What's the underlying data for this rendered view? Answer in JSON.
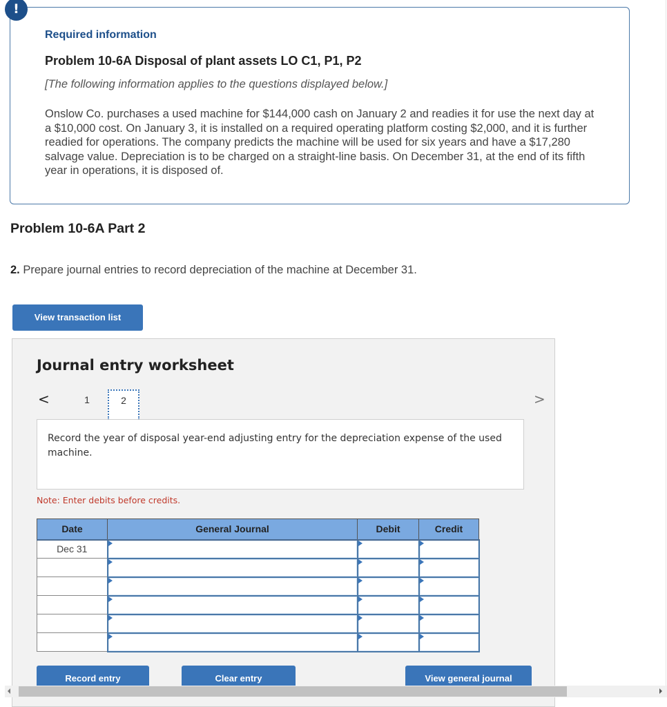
{
  "info": {
    "icon": "alert-icon",
    "icon_glyph": "!",
    "required_label": "Required information",
    "problem_title": "Problem 10-6A Disposal of plant assets LO C1, P1, P2",
    "following_note": "[The following information applies to the questions displayed below.]",
    "scenario": "Onslow Co. purchases a used machine for $144,000 cash on January 2 and readies it for use the next day at a $10,000 cost. On January 3, it is installed on a required operating platform costing $2,000, and it is further readied for operations. The company predicts the machine will be used for six years and have a $17,280 salvage value. Depreciation is to be charged on a straight-line basis. On December 31, at the end of its fifth year in operations, it is disposed of."
  },
  "part": {
    "title": "Problem 10-6A Part 2",
    "question_number": "2.",
    "question_text": " Prepare journal entries to record depreciation of the machine at December 31."
  },
  "buttons": {
    "view_transaction_list": "View transaction list",
    "record_entry": "Record entry",
    "clear_entry": "Clear entry",
    "view_general_journal": "View general journal"
  },
  "worksheet": {
    "title": "Journal entry worksheet",
    "prev_glyph": "<",
    "next_glyph": ">",
    "pages": [
      "1",
      "2"
    ],
    "current_page": "2",
    "instruction": "Record the year of disposal year-end adjusting entry for the depreciation expense of the used machine.",
    "note": "Note: Enter debits before credits.",
    "table": {
      "headers": {
        "date": "Date",
        "general_journal": "General Journal",
        "debit": "Debit",
        "credit": "Credit"
      },
      "rows": [
        {
          "date": "Dec 31",
          "account": "",
          "debit": "",
          "credit": ""
        },
        {
          "date": "",
          "account": "",
          "debit": "",
          "credit": ""
        },
        {
          "date": "",
          "account": "",
          "debit": "",
          "credit": ""
        },
        {
          "date": "",
          "account": "",
          "debit": "",
          "credit": ""
        },
        {
          "date": "",
          "account": "",
          "debit": "",
          "credit": ""
        },
        {
          "date": "",
          "account": "",
          "debit": "",
          "credit": ""
        }
      ]
    }
  },
  "colors": {
    "accent": "#3a75b9",
    "brand_dark": "#1d4f8a",
    "table_header": "#7aa9e0",
    "note_red": "#c0392b"
  }
}
